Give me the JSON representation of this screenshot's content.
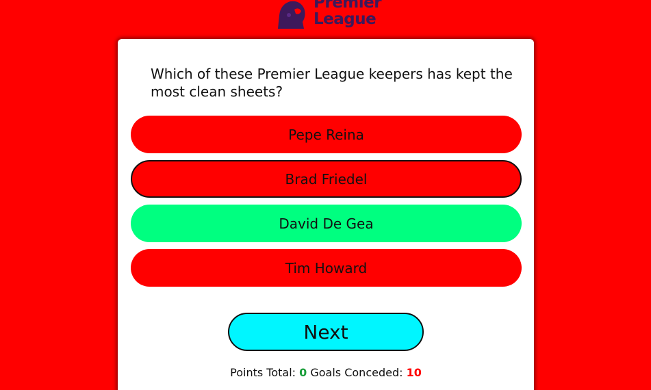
{
  "brand": {
    "logo_line1": "Premier",
    "logo_line2": "League",
    "logo_color": "#3d195b"
  },
  "quiz": {
    "question": "Which of these Premier League keepers has kept the most clean sheets?",
    "answers": [
      {
        "label": "Pepe Reina",
        "state": "wrong",
        "color": "#ff0000"
      },
      {
        "label": "Brad Friedel",
        "state": "wrong-selected",
        "color": "#ff0000"
      },
      {
        "label": "David De Gea",
        "state": "correct",
        "color": "#00ff80"
      },
      {
        "label": "Tim Howard",
        "state": "wrong",
        "color": "#ff0000"
      }
    ],
    "next_label": "Next"
  },
  "score": {
    "points_label": "Points Total:",
    "points_value": "0",
    "goals_label": "Goals Conceded:",
    "goals_value": "10"
  },
  "colors": {
    "background": "#ff0000",
    "next_button": "#00f6ff",
    "points_color": "#1a9e3a",
    "goals_color": "#ff0000"
  }
}
